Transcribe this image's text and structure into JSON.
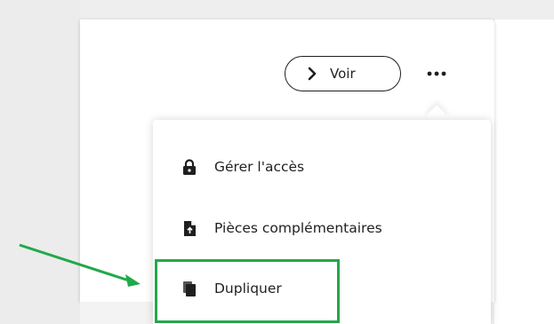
{
  "toolbar": {
    "view_label": "Voir",
    "more_icon": "more-horizontal-icon"
  },
  "menu": {
    "items": [
      {
        "label": "Gérer l'accès",
        "icon": "lock-icon"
      },
      {
        "label": "Pièces complémentaires",
        "icon": "file-upload-icon"
      },
      {
        "label": "Dupliquer",
        "icon": "duplicate-icon"
      }
    ]
  },
  "colors": {
    "annotation": "#22a84a",
    "text": "#1f1f1f",
    "background": "#e8e8e8"
  }
}
